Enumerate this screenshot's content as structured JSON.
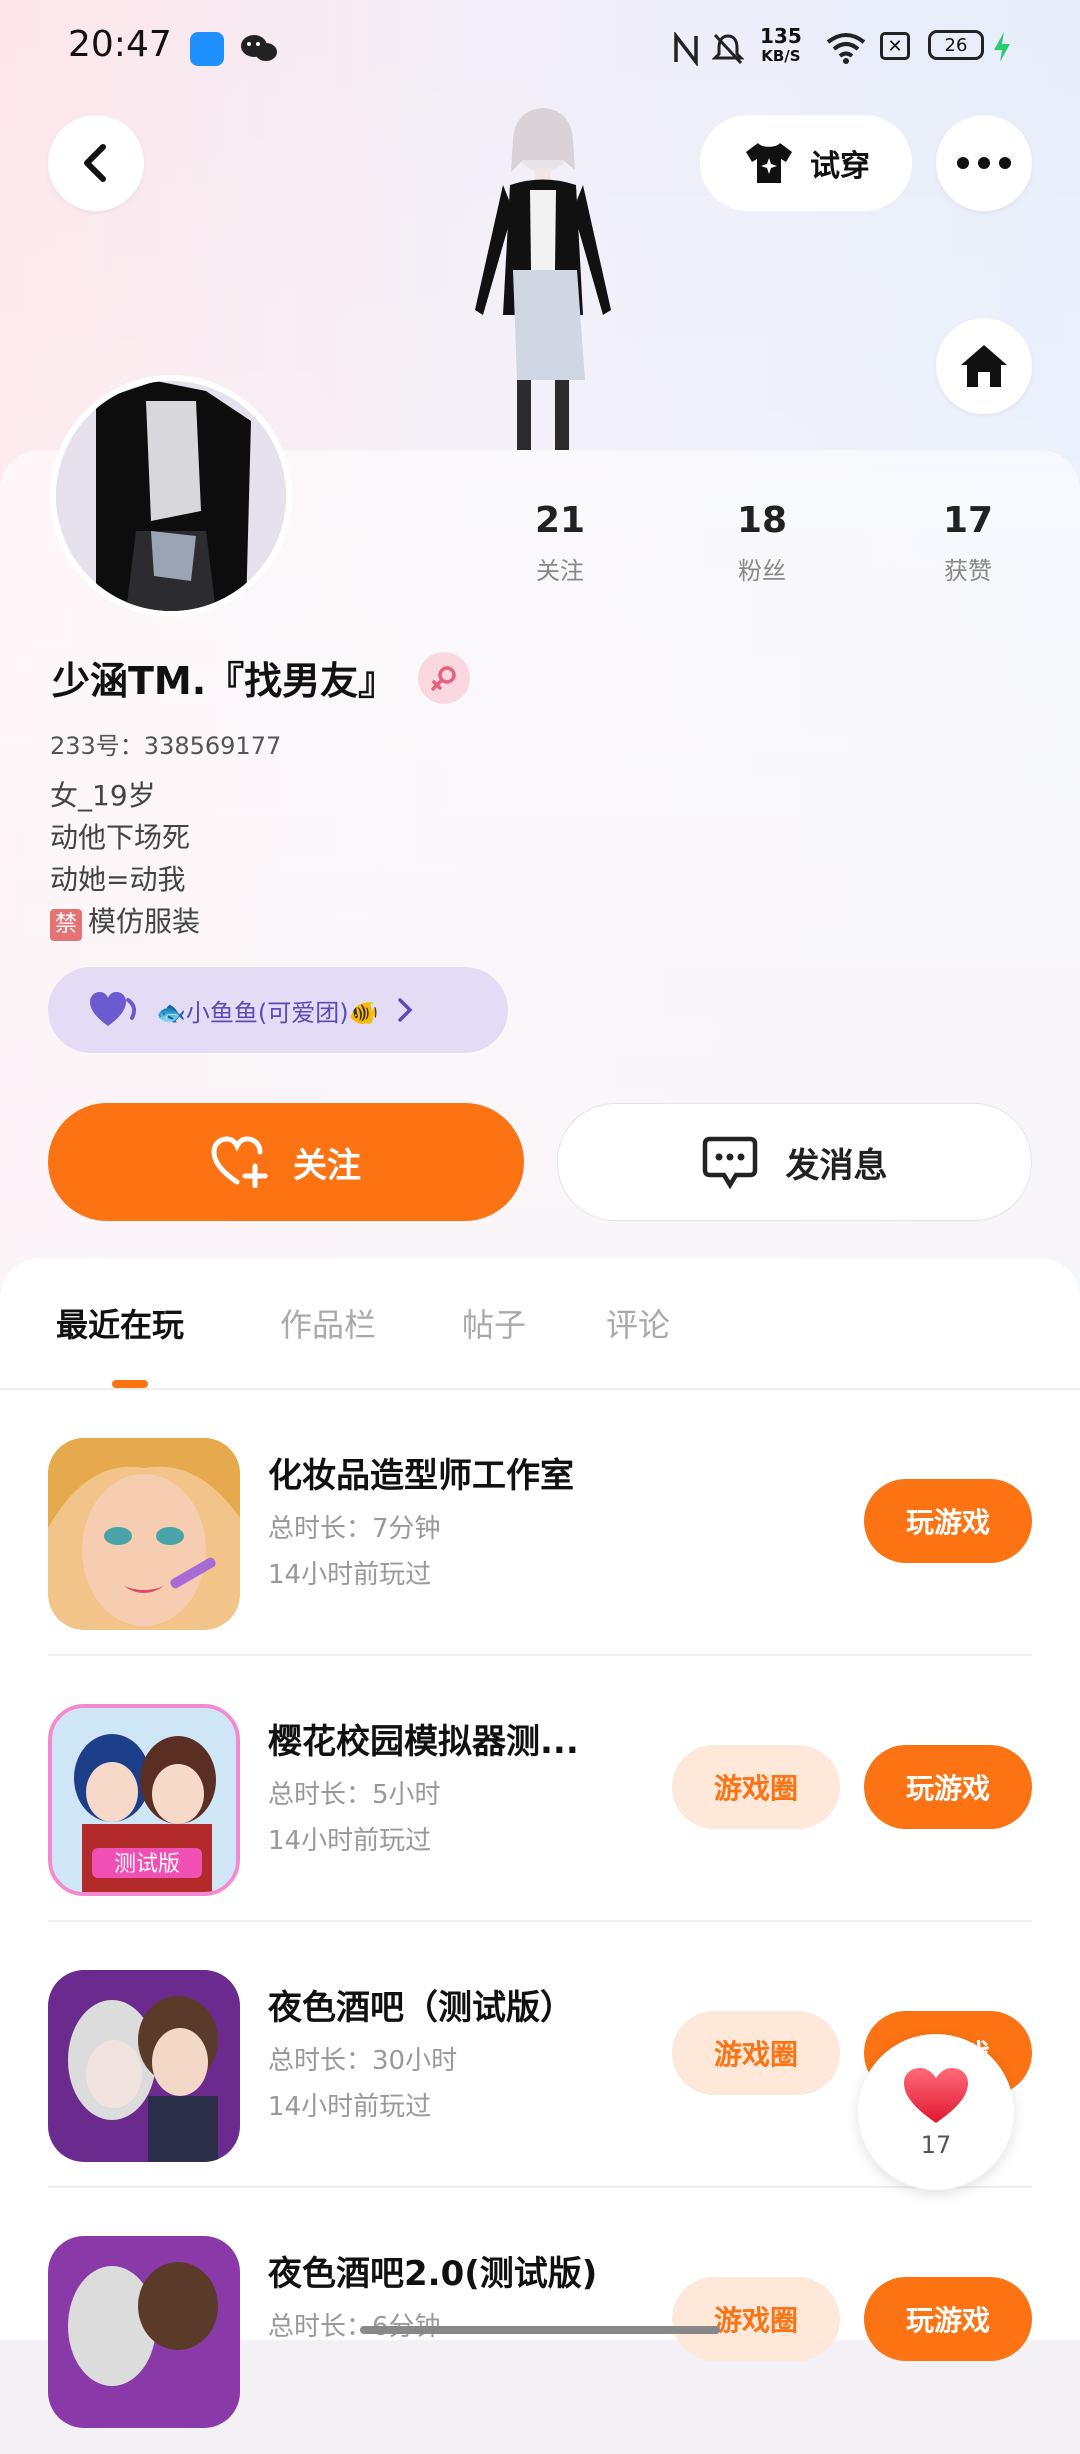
{
  "status_bar": {
    "time": "20:47",
    "net_speed_value": "135",
    "net_speed_unit": "KB/S",
    "battery": "26"
  },
  "header": {
    "tryon_label": "试穿"
  },
  "profile": {
    "stats": [
      {
        "value": "21",
        "label": "关注"
      },
      {
        "value": "18",
        "label": "粉丝"
      },
      {
        "value": "17",
        "label": "获赞"
      }
    ],
    "name": "少涵TM.『找男友』",
    "uid": "233号：338569177",
    "bio": [
      "女_19岁",
      "动他下场死",
      "动她=动我"
    ],
    "bio_ban_badge": "禁",
    "bio_ban_text": "模仿服装",
    "group_label": "🐟小鱼鱼(可爱团)🐠"
  },
  "actions": {
    "follow_label": "关注",
    "message_label": "发消息"
  },
  "tabs": [
    "最近在玩",
    "作品栏",
    "帖子",
    "评论"
  ],
  "games": [
    {
      "title": "化妆品造型师工作室",
      "duration": "总时长：7分钟",
      "last_played": "14小时前玩过",
      "play_label": "玩游戏",
      "circle_label": ""
    },
    {
      "title": "樱花校园模拟器测...",
      "duration": "总时长：5小时",
      "last_played": "14小时前玩过",
      "play_label": "玩游戏",
      "circle_label": "游戏圈"
    },
    {
      "title": "夜色酒吧（测试版）",
      "duration": "总时长：30小时",
      "last_played": "14小时前玩过",
      "play_label": "玩游戏",
      "circle_label": "游戏圈"
    },
    {
      "title": "夜色酒吧2.0(测试版)",
      "duration": "总时长：6分钟",
      "last_played": "",
      "play_label": "玩游戏",
      "circle_label": "游戏圈"
    }
  ],
  "like_float": {
    "count": "17"
  },
  "colors": {
    "accent": "#fb7313",
    "accent_soft": "#fde8da",
    "group_bg": "#e4dcf4"
  }
}
